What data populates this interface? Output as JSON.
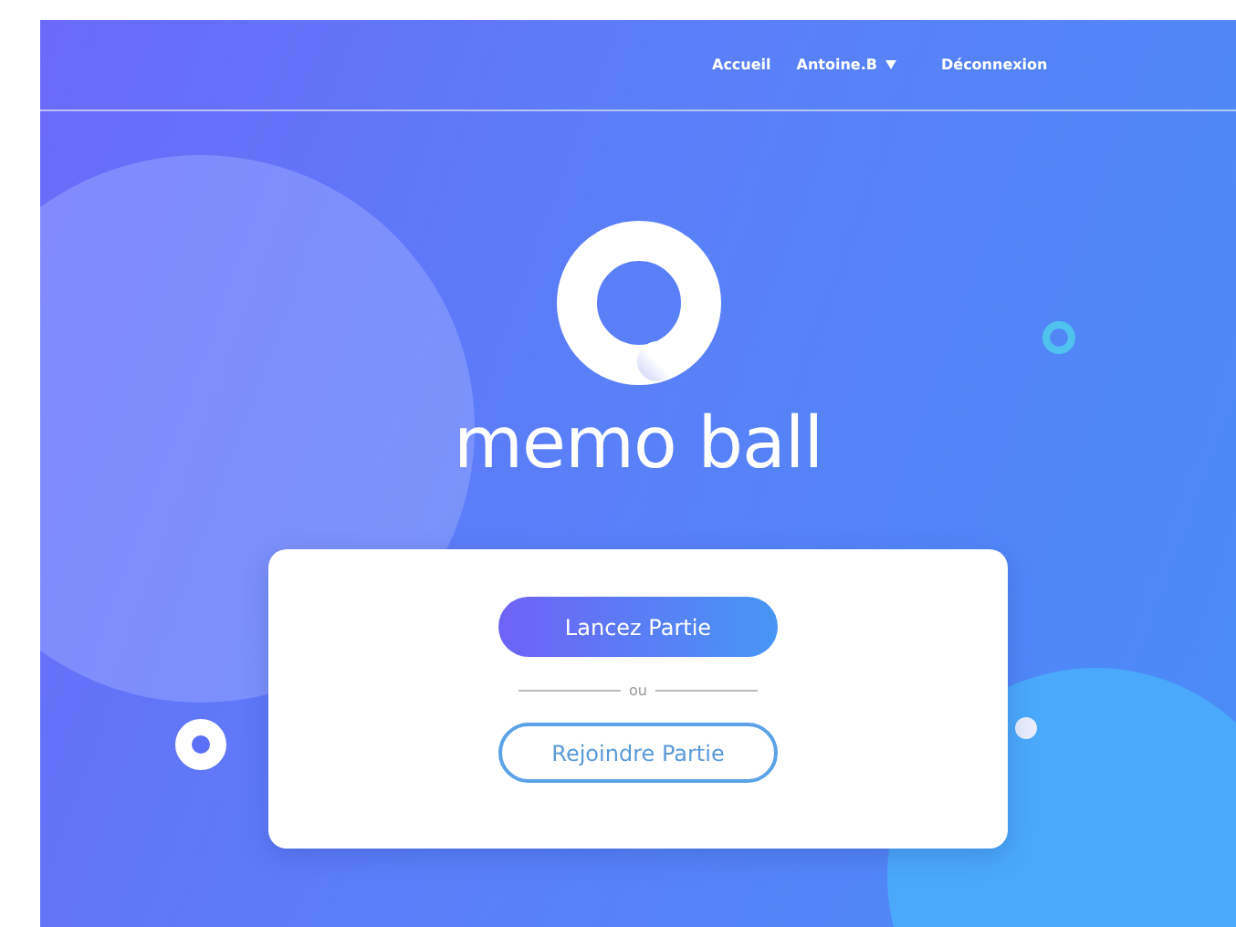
{
  "nav": {
    "items": [
      {
        "label": "Accueil",
        "kind": "link"
      },
      {
        "label": "Antoine.B",
        "kind": "dropdown"
      },
      {
        "label": "Déconnexion",
        "kind": "link"
      }
    ]
  },
  "brand": {
    "wordmark": "memo ball"
  },
  "card": {
    "primary_button": "Lancez Partie",
    "divider_label": "ou",
    "secondary_button": "Rejoindre Partie"
  }
}
